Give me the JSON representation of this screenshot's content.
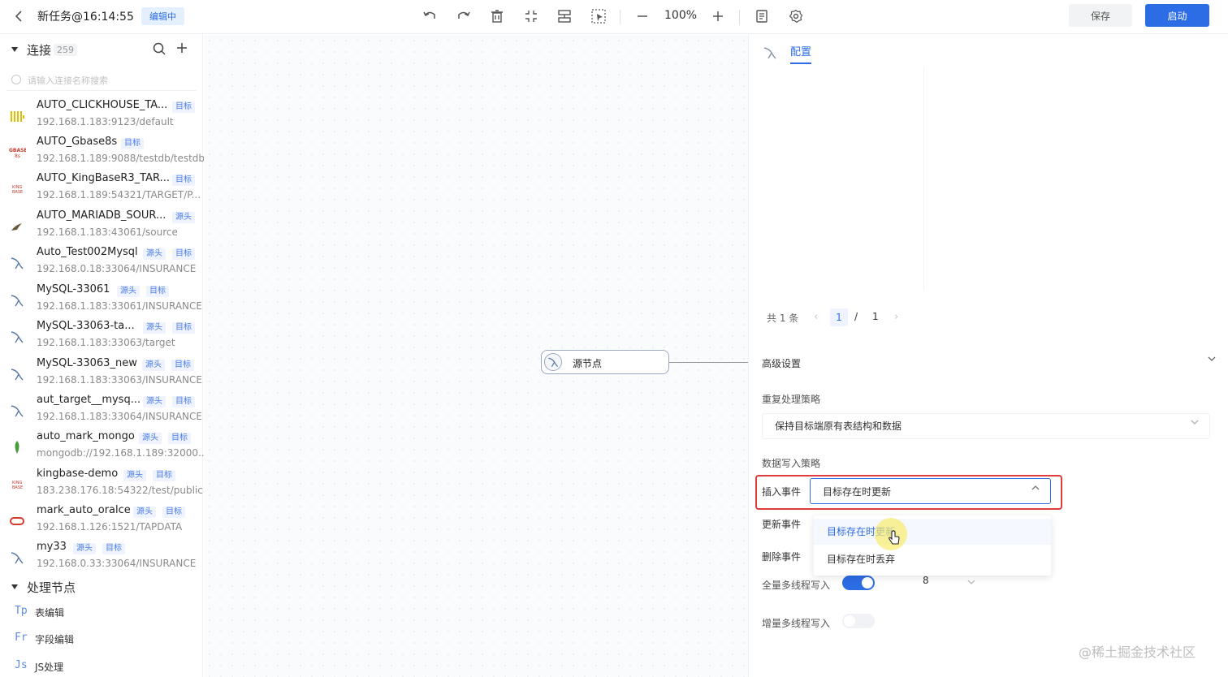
{
  "header": {
    "task_title": "新任务@16:14:55",
    "edit_badge": "编辑中",
    "zoom": "100%",
    "save_label": "保存",
    "start_label": "启动"
  },
  "connections": {
    "title": "连接",
    "count": "259",
    "search_placeholder": "请输入连接名称搜索",
    "items": [
      {
        "name": "AUTO_CLICKHOUSE_TA...",
        "addr": "192.168.1.183:9123/default",
        "tags": [
          "目标"
        ],
        "icon": "clickhouse-icon"
      },
      {
        "name": "AUTO_Gbase8s",
        "addr": "192.168.1.189:9088/testdb/testdb",
        "tags": [
          "目标"
        ],
        "icon": "gbase-icon"
      },
      {
        "name": "AUTO_KingBaseR3_TAR...",
        "addr": "192.168.1.189:54321/TARGET/P...",
        "tags": [
          "目标"
        ],
        "icon": "kingbase-icon"
      },
      {
        "name": "AUTO_MARIADB_SOUR...",
        "addr": "192.168.1.183:43061/source",
        "tags": [
          "源头"
        ],
        "icon": "mariadb-icon"
      },
      {
        "name": "Auto_Test002Mysql",
        "addr": "192.168.0.18:33064/INSURANCE",
        "tags": [
          "源头",
          "目标"
        ],
        "icon": "mysql-icon"
      },
      {
        "name": "MySQL-33061",
        "addr": "192.168.1.183:33061/INSURANCE",
        "tags": [
          "源头",
          "目标"
        ],
        "icon": "mysql-icon"
      },
      {
        "name": "MySQL-33063-ta...",
        "addr": "192.168.1.183:33063/target",
        "tags": [
          "源头",
          "目标"
        ],
        "icon": "mysql-icon"
      },
      {
        "name": "MySQL-33063_new",
        "addr": "192.168.1.183:33063/INSURANCE",
        "tags": [
          "源头",
          "目标"
        ],
        "icon": "mysql-icon"
      },
      {
        "name": "aut_target__mysq...",
        "addr": "192.168.1.183:33064/INSURANCE",
        "tags": [
          "源头",
          "目标"
        ],
        "icon": "mysql-icon"
      },
      {
        "name": "auto_mark_mongo",
        "addr": "mongodb://192.168.1.189:32000...",
        "tags": [
          "源头",
          "目标"
        ],
        "icon": "mongodb-icon"
      },
      {
        "name": "kingbase-demo",
        "addr": "183.238.176.18:54322/test/public",
        "tags": [
          "源头",
          "目标"
        ],
        "icon": "kingbase-icon"
      },
      {
        "name": "mark_auto_oralce",
        "addr": "192.168.1.126:1521/TAPDATA",
        "tags": [
          "源头",
          "目标"
        ],
        "icon": "oracle-icon"
      },
      {
        "name": "my33",
        "addr": "192.168.0.33:33064/INSURANCE",
        "tags": [
          "源头",
          "目标"
        ],
        "icon": "mysql-icon"
      }
    ]
  },
  "processing": {
    "title": "处理节点",
    "items": [
      {
        "code": "Tp",
        "label": "表编辑"
      },
      {
        "code": "Fr",
        "label": "字段编辑"
      },
      {
        "code": "Js",
        "label": "JS处理"
      }
    ]
  },
  "canvas": {
    "node_label": "源节点"
  },
  "panel": {
    "tab_label": "配置",
    "pager": {
      "total": "共 1 条",
      "current": "1",
      "separator": "/",
      "pages": "1"
    },
    "advanced_title": "高级设置",
    "dup_strategy_label": "重复处理策略",
    "dup_strategy_value": "保持目标端原有表结构和数据",
    "write_strategy_label": "数据写入策略",
    "insert_label": "插入事件",
    "insert_value": "目标存在时更新",
    "update_label": "更新事件",
    "delete_label": "删除事件",
    "dropdown_options": [
      "目标存在时更新",
      "目标存在时丢弃"
    ],
    "full_thread_label": "全量多线程写入",
    "full_thread_value": "8",
    "full_thread_on": true,
    "incr_thread_label": "增量多线程写入",
    "incr_thread_on": false
  },
  "watermark": "@稀土掘金技术社区",
  "colors": {
    "accent": "#2c6ce5",
    "highlight_border": "#e03c3c"
  }
}
